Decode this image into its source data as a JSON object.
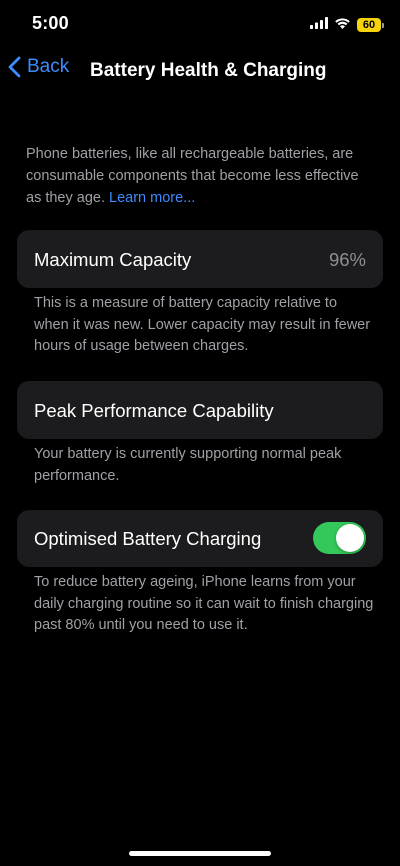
{
  "status_bar": {
    "time": "5:00",
    "battery_level": "60",
    "battery_color": "#f5d20b",
    "signal_icon": "cellular-signal-icon",
    "wifi_icon": "wifi-icon"
  },
  "nav": {
    "back_label": "Back",
    "title": "Battery Health & Charging",
    "accent_color": "#3d8bfd"
  },
  "intro": {
    "text": "Phone batteries, like all rechargeable batteries, are consumable components that become less effective as they age. ",
    "link": "Learn more..."
  },
  "maximum_capacity": {
    "label": "Maximum Capacity",
    "value": "96%",
    "footnote": "This is a measure of battery capacity relative to when it was new. Lower capacity may result in fewer hours of usage between charges."
  },
  "peak_performance": {
    "label": "Peak Performance Capability",
    "footnote": "Your battery is currently supporting normal peak performance."
  },
  "optimised_charging": {
    "label": "Optimised Battery Charging",
    "enabled": true,
    "toggle_color": "#34c759",
    "footnote": "To reduce battery ageing, iPhone learns from your daily charging routine so it can wait to finish charging past 80% until you need to use it."
  }
}
